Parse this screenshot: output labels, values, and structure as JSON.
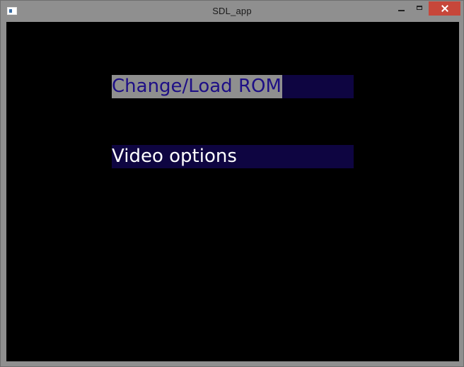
{
  "window": {
    "title": "SDL_app"
  },
  "icons": {
    "app": "app-window-icon",
    "minimize": "minimize-icon",
    "maximize": "maximize-icon",
    "close": "close-icon"
  },
  "colors": {
    "menu_bar": "#0e0541",
    "selected_highlight": "#8f8f8f",
    "selected_text": "#1e0f86",
    "unselected_text": "#ffffff",
    "close_button": "#c7473a",
    "client_bg": "#000000"
  },
  "menu": {
    "items": [
      {
        "label": "Change/Load ROM",
        "selected": true
      },
      {
        "label": "Video options",
        "selected": false
      }
    ]
  }
}
